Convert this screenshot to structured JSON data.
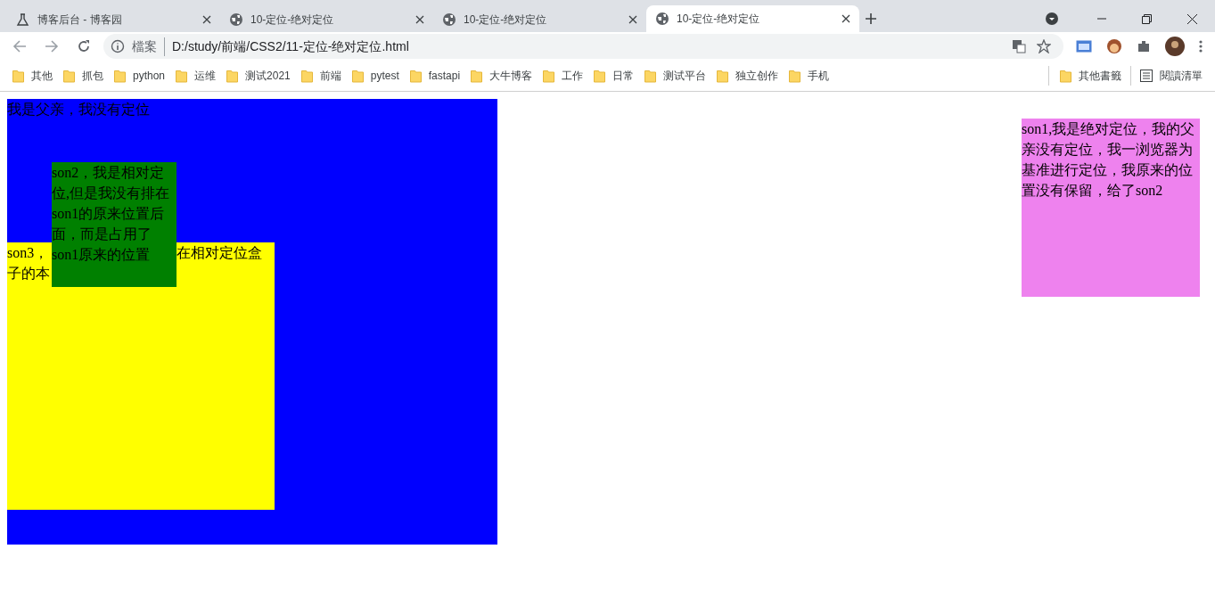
{
  "browser": {
    "tabs": [
      {
        "title": "博客后台 - 博客园",
        "kind": "site",
        "selected": false
      },
      {
        "title": "10-定位-绝对定位",
        "kind": "globe",
        "selected": false
      },
      {
        "title": "10-定位-绝对定位",
        "kind": "globe",
        "selected": false
      },
      {
        "title": "10-定位-绝对定位",
        "kind": "globe",
        "selected": true
      }
    ],
    "address": {
      "security_label": "檔案",
      "url": "D:/study/前端/CSS2/11-定位-绝对定位.html"
    },
    "bookmarks": [
      "其他",
      "抓包",
      "python",
      "运维",
      "测试2021",
      "前端",
      "pytest",
      "fastapi",
      "大牛博客",
      "工作",
      "日常",
      "测试平台",
      "独立创作",
      "手机"
    ],
    "other_bookmarks": "其他書籤",
    "reading_list": "閱讀清單"
  },
  "page": {
    "parent_text": "我是父亲，我没有定位",
    "son1_text": "son1,我是绝对定位，我的父亲没有定位，我一浏览器为基准进行定位，我原来的位置没有保留，给了son2",
    "son2_text": "son2，我是相对定位,但是我没有排在son1的原来位置后面，而是占用了son1原来的位置",
    "son3_lines": [
      {
        "left": "son3，",
        "right": "在相对定位盒"
      },
      {
        "left": "子的本"
      }
    ]
  }
}
